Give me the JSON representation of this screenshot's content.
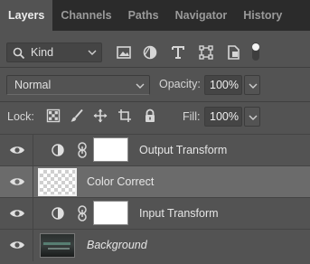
{
  "tabs": [
    {
      "label": "Layers",
      "active": true
    },
    {
      "label": "Channels",
      "active": false
    },
    {
      "label": "Paths",
      "active": false
    },
    {
      "label": "Navigator",
      "active": false
    },
    {
      "label": "History",
      "active": false
    }
  ],
  "filter": {
    "kind_label": "Kind",
    "icons": [
      "image-filter-icon",
      "adjustment-filter-icon",
      "type-filter-icon",
      "shape-filter-icon",
      "smart-object-filter-icon",
      "filter-toggle-icon"
    ]
  },
  "blend": {
    "mode": "Normal",
    "opacity_label": "Opacity:",
    "opacity_value": "100%"
  },
  "lock": {
    "label": "Lock:",
    "fill_label": "Fill:",
    "fill_value": "100%",
    "icons": [
      "lock-transparent-pixels-icon",
      "lock-image-pixels-icon",
      "lock-position-icon",
      "lock-artboard-icon",
      "lock-all-icon"
    ]
  },
  "layers": [
    {
      "name": "Output Transform",
      "type": "adjustment",
      "indented": true,
      "selected": false,
      "italic": false
    },
    {
      "name": "Color Correct",
      "type": "group",
      "indented": false,
      "selected": true,
      "italic": false
    },
    {
      "name": "Input Transform",
      "type": "adjustment",
      "indented": true,
      "selected": false,
      "italic": false
    },
    {
      "name": "Background",
      "type": "image",
      "indented": false,
      "selected": false,
      "italic": true
    }
  ],
  "colors": {
    "panel": "#535353",
    "tab_bar": "#2b2b2b",
    "selected_row": "#6b6b6b"
  }
}
